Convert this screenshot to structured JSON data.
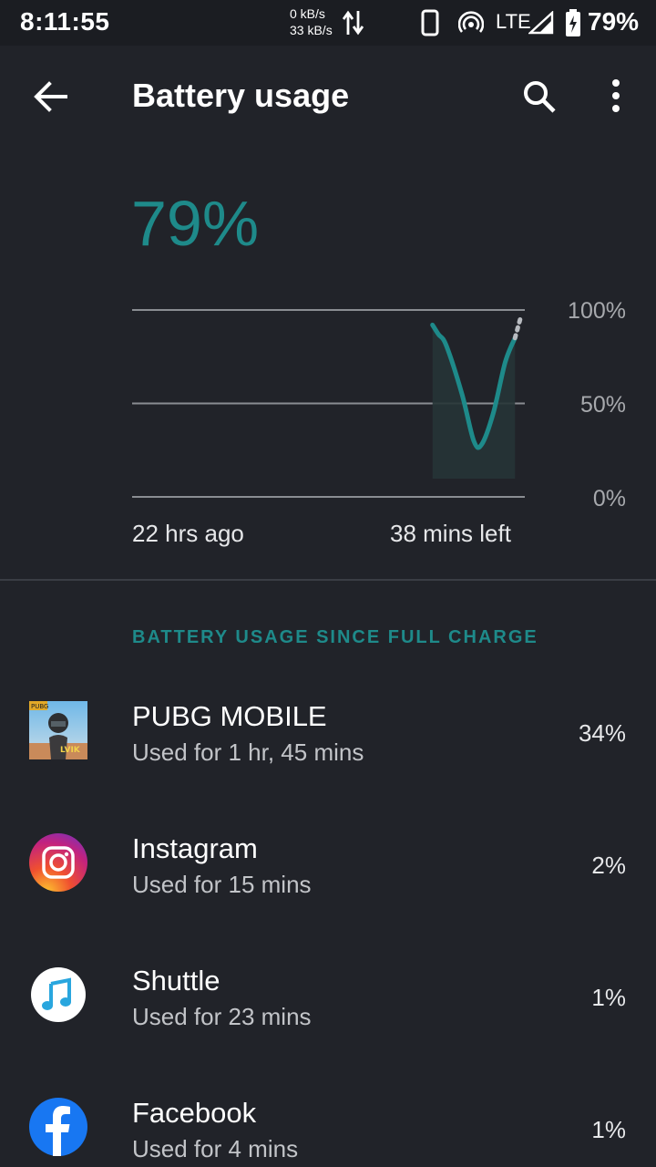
{
  "status_bar": {
    "time": "8:11:55",
    "speed_up": "0 kB/s",
    "speed_down": "33 kB/s",
    "network": "LTE",
    "battery_pct": "79%"
  },
  "app_bar": {
    "title": "Battery usage",
    "back_icon": "arrow-back-icon",
    "search_icon": "search-icon",
    "more_icon": "more-vert-icon"
  },
  "summary": {
    "level": "79%"
  },
  "chart_data": {
    "type": "line",
    "y_ticks": [
      "100%",
      "50%",
      "0%"
    ],
    "ylim": [
      0,
      100
    ],
    "x_labels": {
      "start": "22 hrs ago",
      "end": "38 mins left"
    },
    "series": [
      {
        "x": [
          0.765,
          0.78,
          0.8,
          0.84,
          0.87,
          0.89,
          0.92,
          0.95,
          0.975
        ],
        "values": [
          92,
          87,
          81,
          55,
          30,
          28,
          45,
          72,
          85
        ]
      }
    ],
    "projection": {
      "x": [
        0.975,
        1.0
      ],
      "values": [
        85,
        97
      ]
    },
    "colors": {
      "line": "#1e8a8a",
      "grid": "#8a8d92",
      "projection": "#b8bbc0"
    }
  },
  "section": {
    "header": "BATTERY USAGE SINCE FULL CHARGE"
  },
  "apps": [
    {
      "name": "PUBG MOBILE",
      "usage": "Used for 1 hr, 45 mins",
      "percent": "34%",
      "icon": "pubg-icon"
    },
    {
      "name": "Instagram",
      "usage": "Used for 15 mins",
      "percent": "2%",
      "icon": "instagram-icon"
    },
    {
      "name": "Shuttle",
      "usage": "Used for 23 mins",
      "percent": "1%",
      "icon": "shuttle-icon"
    },
    {
      "name": "Facebook",
      "usage": "Used for 4 mins",
      "percent": "1%",
      "icon": "facebook-icon"
    }
  ]
}
